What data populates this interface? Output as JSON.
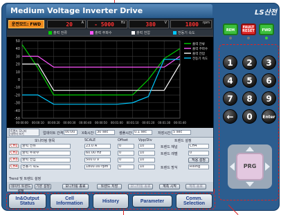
{
  "title": "Medium Voltage Inverter Drive",
  "brand": "LS산전",
  "status": {
    "mode": "운전모드: FWD",
    "readouts": [
      {
        "value": "20",
        "unit": "A"
      },
      {
        "value": "- 5000",
        "unit": "Hz"
      },
      {
        "value": "380",
        "unit": "V"
      },
      {
        "value": "1800",
        "unit": "rpm"
      }
    ]
  },
  "legend": [
    {
      "label": "출력 전류",
      "color": "#00d000"
    },
    {
      "label": "출력 주파수",
      "color": "#ff55ff"
    },
    {
      "label": "출력 전압",
      "color": "#ffffff"
    },
    {
      "label": "전동기 속도",
      "color": "#00c8ff"
    }
  ],
  "chart_data": {
    "type": "line",
    "title": "",
    "xlabel": "",
    "ylabel": "",
    "y_ticks": [
      "50",
      "40",
      "30",
      "20",
      "10",
      "0",
      "-10",
      "-20",
      "-30",
      "-40",
      "-50"
    ],
    "x_ticks": [
      "00:00:00",
      "00:00:10",
      "00:00:20",
      "00:00:30",
      "00:00:40",
      "00:00:50",
      "00:01:00",
      "00:01:10",
      "00:01:20",
      "00:01:30",
      "00:01:40"
    ],
    "ylim": [
      -50,
      50
    ],
    "grid": true,
    "legend_placement": "top-right",
    "series": [
      {
        "name": "출력 전류",
        "color": "#00d000",
        "values": [
          45,
          15,
          -20,
          -20,
          -20,
          -20,
          -20,
          -20,
          0,
          27,
          40
        ]
      },
      {
        "name": "출력 주파수",
        "color": "#ff55ff",
        "values": [
          30,
          30,
          16,
          16,
          16,
          16,
          16,
          16,
          16,
          16,
          30
        ]
      },
      {
        "name": "출력 전압",
        "color": "#ffffff",
        "values": [
          20,
          20,
          -14,
          -14,
          -14,
          -14,
          -14,
          -14,
          -14,
          -14,
          20
        ]
      },
      {
        "name": "전동기 속도",
        "color": "#00c8ff",
        "values": [
          -20,
          -20,
          -32,
          -32,
          -32,
          -32,
          -32,
          -30,
          -22,
          26,
          26
        ]
      }
    ]
  },
  "controls": {
    "label": "트렌드 모니터\n데이터 보기",
    "fields": [
      {
        "label": "업데이트 간격",
        "value": "00:00"
      },
      {
        "label": "X축시간",
        "value": "30 sec"
      },
      {
        "label": "샘플시간",
        "value": "0.1 sec"
      },
      {
        "label": "저장시간",
        "value": "5 sec"
      }
    ]
  },
  "table": {
    "headers": [
      "모니터링 항목",
      "SCALE",
      "Offset",
      "Vpp/Div",
      "트렌드 설정"
    ],
    "rows": [
      {
        "tag": "CH1",
        "item": "출력 전류",
        "scale": "23.0 A",
        "offset": "0",
        "div": "10"
      },
      {
        "tag": "CH2",
        "item": "출력 주파수",
        "scale": "60.00 Hz",
        "offset": "0",
        "div": "10"
      },
      {
        "tag": "CH3",
        "item": "출력 전압",
        "scale": "500.0 V",
        "offset": "0",
        "div": "10"
      },
      {
        "tag": "CH4",
        "item": "전동기 속도",
        "scale": "1800.00 rpm",
        "offset": "0",
        "div": "10"
      }
    ],
    "trend": [
      {
        "label": "트렌드 채널",
        "value": "CH4"
      },
      {
        "label": "트렌드 레벨",
        "value": "0"
      },
      {
        "label": "트렌드 설정",
        "value": "적용 설정"
      },
      {
        "label": "트렌드 방식",
        "value": "Rising"
      }
    ]
  },
  "bottom_buttons": [
    "데이터 트렌드 설정",
    "기본 설정",
    "모니터링 종료",
    "트렌드 저장",
    "모니터링 종료",
    "계측 시작",
    "계측 종료"
  ],
  "bottom_label": "Trend 및 트렌드 설정",
  "tabs": [
    [
      "In&Output",
      "Status"
    ],
    [
      "Cell",
      "Information"
    ],
    [
      "History"
    ],
    [
      "Parameter"
    ],
    [
      "Comm.",
      "Selection"
    ]
  ],
  "func_keys": [
    {
      "label": "REM",
      "color": "#3cbf3c"
    },
    {
      "label": "FAULT RESET",
      "color": "#e02a2a"
    },
    {
      "label": "FWD",
      "color": "#3cbf3c"
    }
  ],
  "keypad": [
    "1",
    "2",
    "3",
    "4",
    "5",
    "6",
    "7",
    "8",
    "9",
    "←",
    "0",
    "Enter"
  ],
  "nav_center": "PRG"
}
